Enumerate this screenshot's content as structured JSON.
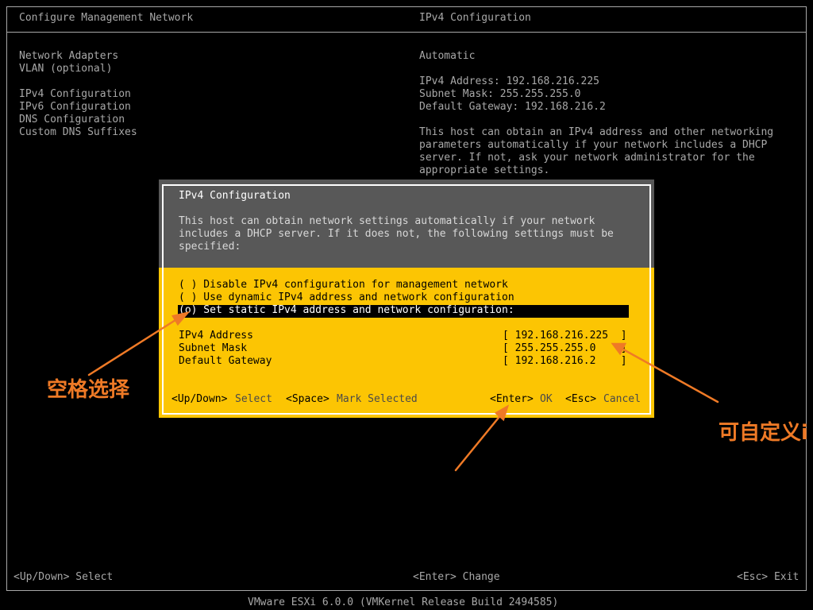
{
  "header": {
    "left_title": "Configure Management Network",
    "right_title": "IPv4 Configuration"
  },
  "menu": {
    "items": [
      "Network Adapters",
      "VLAN (optional)",
      "IPv4 Configuration",
      "IPv6 Configuration",
      "DNS Configuration",
      "Custom DNS Suffixes"
    ]
  },
  "details": {
    "mode": "Automatic",
    "ipv4_address": "IPv4 Address: 192.168.216.225",
    "subnet_mask": "Subnet Mask: 255.255.255.0",
    "default_gateway": "Default Gateway: 192.168.216.2",
    "desc_lines": [
      "This host can obtain an IPv4 address and other networking",
      "parameters automatically if your network includes a DHCP",
      "server. If not, ask your network administrator for the",
      "appropriate settings."
    ]
  },
  "dialog": {
    "title": "IPv4 Configuration",
    "desc_lines": [
      "This host can obtain network settings automatically if your network",
      "includes a DHCP server. If it does not, the following settings must be",
      "specified:"
    ],
    "options": [
      "( ) Disable IPv4 configuration for management network",
      "( ) Use dynamic IPv4 address and network configuration",
      "(o) Set static IPv4 address and network configuration:"
    ],
    "fields": [
      {
        "label": "IPv4 Address",
        "value": "[ 192.168.216.225  ]"
      },
      {
        "label": "Subnet Mask",
        "value": "[ 255.255.255.0    ]"
      },
      {
        "label": "Default Gateway",
        "value": "[ 192.168.216.2    ]"
      }
    ],
    "footer": {
      "updown_key": "<Up/Down>",
      "updown_action": "Select",
      "space_key": "<Space>",
      "space_action": "Mark Selected",
      "enter_key": "<Enter>",
      "enter_action": "OK",
      "esc_key": "<Esc>",
      "esc_action": "Cancel"
    }
  },
  "footer": {
    "select": "<Up/Down> Select",
    "change": "<Enter> Change",
    "exit": "<Esc> Exit"
  },
  "version": "VMware ESXi 6.0.0 (VMKernel Release Build 2494585)",
  "annotations": {
    "space_select": "空格选择",
    "customizable": "可自定义i"
  },
  "colors": {
    "dialog_yellow": "#fcc503",
    "dialog_grey": "#585858",
    "annotation_orange": "#ef7a26"
  }
}
